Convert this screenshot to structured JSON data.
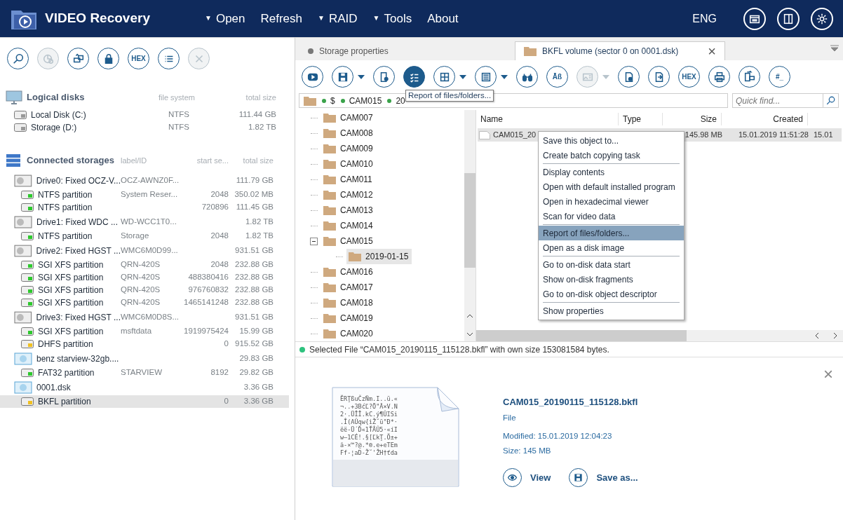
{
  "app": {
    "title": "VIDEO Recovery"
  },
  "menu": [
    {
      "label": "Open",
      "dropdown": true
    },
    {
      "label": "Refresh",
      "dropdown": false
    },
    {
      "label": "RAID",
      "dropdown": true
    },
    {
      "label": "Tools",
      "dropdown": true
    },
    {
      "label": "About",
      "dropdown": false
    }
  ],
  "dropdown_mark": "▼",
  "language": "ENG",
  "header_buttons": [
    {
      "kind": "window"
    },
    {
      "kind": "sidebar"
    },
    {
      "kind": "gear"
    }
  ],
  "left_toolbar": [
    {
      "kind": "magnifier",
      "disabled": false
    },
    {
      "kind": "pie",
      "disabled": true
    },
    {
      "kind": "drives",
      "disabled": false
    },
    {
      "kind": "lock",
      "disabled": false
    },
    {
      "kind": "hex",
      "label": "HEX",
      "disabled": false
    },
    {
      "kind": "list",
      "disabled": false
    },
    {
      "kind": "close",
      "disabled": true
    }
  ],
  "logical_disks": {
    "title": "Logical disks",
    "columns": [
      "file system",
      "total size"
    ],
    "rows": [
      {
        "name": "Local Disk (C:)",
        "file_system": "NTFS",
        "size": "111.44 GB"
      },
      {
        "name": "Storage (D:)",
        "file_system": "NTFS",
        "size": "1.82 TB"
      }
    ]
  },
  "storages": {
    "title": "Connected storages",
    "columns": [
      "label/ID",
      "start se...",
      "total size"
    ],
    "devices": [
      {
        "name": "Drive0: Fixed OCZ-V...",
        "kind": "drive",
        "label": "OCZ-AWNZ0F...",
        "size": "111.79 GB",
        "selected": false,
        "children": [
          {
            "name": "NTFS partition",
            "label": "System Reser...",
            "start": "2048",
            "size": "350.02 MB",
            "color": "#2ec82e",
            "selected": false
          },
          {
            "name": "NTFS partition",
            "start": "720896",
            "size": "111.45 GB",
            "color": "#2ec82e",
            "selected": false
          }
        ]
      },
      {
        "name": "Drive1: Fixed WDC ...",
        "kind": "drive",
        "label": "WD-WCC1T0...",
        "size": "1.82 TB",
        "selected": false,
        "children": [
          {
            "name": "NTFS partition",
            "label": "Storage",
            "start": "2048",
            "size": "1.82 TB",
            "color": "#2ec82e",
            "selected": false
          }
        ]
      },
      {
        "name": "Drive2: Fixed HGST ...",
        "kind": "drive",
        "label": "WMC6M0D99...",
        "size": "931.51 GB",
        "selected": false,
        "children": [
          {
            "name": "SGI XFS partition",
            "label": "QRN-420S",
            "start": "2048",
            "size": "232.88 GB",
            "color": "#2ec82e",
            "selected": false
          },
          {
            "name": "SGI XFS partition",
            "label": "QRN-420S",
            "start": "488380416",
            "size": "232.88 GB",
            "color": "#2ec82e",
            "selected": false
          },
          {
            "name": "SGI XFS partition",
            "label": "QRN-420S",
            "start": "976760832",
            "size": "232.88 GB",
            "color": "#2ec82e",
            "selected": false
          },
          {
            "name": "SGI XFS partition",
            "label": "QRN-420S",
            "start": "1465141248",
            "size": "232.88 GB",
            "color": "#2ec82e",
            "selected": false
          }
        ]
      },
      {
        "name": "Drive3: Fixed HGST ...",
        "kind": "drive",
        "label": "WMC6M0D8S...",
        "size": "931.51 GB",
        "selected": false,
        "children": [
          {
            "name": "SGI XFS partition",
            "label": "msftdata",
            "start": "1919975424",
            "size": "15.99 GB",
            "color": "#2ec82e",
            "selected": false
          },
          {
            "name": "DHFS partition",
            "start": "0",
            "size": "915.52 GB",
            "color": "#f0c020",
            "selected": false
          }
        ]
      },
      {
        "name": "benz starview-32gb....",
        "kind": "image",
        "size": "29.83 GB",
        "selected": false,
        "children": [
          {
            "name": "FAT32 partition",
            "label": "STARVIEW",
            "start": "8192",
            "size": "29.82 GB",
            "color": "#2ec82e",
            "selected": false
          }
        ]
      },
      {
        "name": "0001.dsk",
        "kind": "image",
        "size": "3.36 GB",
        "selected": false,
        "children": [
          {
            "name": "BKFL partition",
            "start": "0",
            "size": "3.36 GB",
            "color": "#f0c020",
            "selected": true
          }
        ]
      }
    ]
  },
  "tabs": [
    {
      "label": "Storage properties",
      "kind": "properties",
      "selected": false,
      "closable": false
    },
    {
      "label": "BKFL volume (sector 0 on 0001.dsk)",
      "kind": "folder",
      "selected": true,
      "closable": true
    }
  ],
  "tab_close": "×",
  "toolbar": [
    {
      "kind": "play",
      "disabled": false
    },
    {
      "kind": "save",
      "dropdown": true,
      "disabled": false
    },
    {
      "kind": "filegear",
      "disabled": false
    },
    {
      "kind": "checklist",
      "active": true,
      "disabled": false
    },
    {
      "kind": "grid",
      "dropdown": true,
      "disabled": false
    },
    {
      "kind": "panel",
      "dropdown": true,
      "disabled": false
    },
    {
      "kind": "binoculars",
      "disabled": false
    },
    {
      "kind": "spell",
      "label": "Āß",
      "disabled": false
    },
    {
      "kind": "picture",
      "dropdown": true,
      "disabled": true
    },
    {
      "kind": "docgear",
      "disabled": false
    },
    {
      "kind": "docexport",
      "disabled": false
    },
    {
      "kind": "hex",
      "label": "HEX",
      "disabled": false
    },
    {
      "kind": "printer",
      "disabled": false
    },
    {
      "kind": "transfer",
      "disabled": false
    },
    {
      "kind": "hash",
      "label": "#_",
      "disabled": false
    }
  ],
  "tooltip": "Report of files/folders...",
  "path": {
    "crumbs": [
      "$",
      "CAM015",
      "20"
    ]
  },
  "quick_find": {
    "placeholder": "Quick find..."
  },
  "tree": [
    {
      "label": "CAM007",
      "selected": false
    },
    {
      "label": "CAM008",
      "selected": false
    },
    {
      "label": "CAM009",
      "selected": false
    },
    {
      "label": "CAM010",
      "selected": false
    },
    {
      "label": "CAM011",
      "selected": false
    },
    {
      "label": "CAM012",
      "selected": false
    },
    {
      "label": "CAM013",
      "selected": false
    },
    {
      "label": "CAM014",
      "selected": false
    },
    {
      "label": "CAM015",
      "selected": false,
      "expanded": true,
      "children": [
        {
          "label": "2019-01-15",
          "selected": true
        }
      ]
    },
    {
      "label": "CAM016",
      "selected": false
    },
    {
      "label": "CAM017",
      "selected": false
    },
    {
      "label": "CAM018",
      "selected": false
    },
    {
      "label": "CAM019",
      "selected": false
    },
    {
      "label": "CAM020",
      "selected": false
    }
  ],
  "file_list": {
    "columns": [
      "Name",
      "Type",
      "Size",
      "Created"
    ],
    "rows": [
      {
        "name": "CAM015_20",
        "size": "145.98 MB",
        "created": "15.01.2019 11:51:28",
        "column_5": "15.01",
        "selected": true
      }
    ]
  },
  "context_menu": {
    "groups": [
      [
        {
          "label": "Save this object to...",
          "selected": false
        },
        {
          "label": "Create batch copying task",
          "selected": false
        }
      ],
      [
        {
          "label": "Display contents",
          "selected": false
        },
        {
          "label": "Open with default installed program",
          "selected": false
        },
        {
          "label": "Open in hexadecimal viewer",
          "selected": false
        },
        {
          "label": "Scan for video data",
          "selected": false
        }
      ],
      [
        {
          "label": "Report of files/folders...",
          "selected": true
        },
        {
          "label": "Open as a disk image",
          "selected": false
        }
      ],
      [
        {
          "label": "Go to on-disk data start",
          "selected": false
        },
        {
          "label": "Show on-disk fragments",
          "selected": false
        },
        {
          "label": "Go to on-disk object descriptor",
          "selected": false
        }
      ],
      [
        {
          "label": "Show properties",
          "selected": false
        }
      ]
    ]
  },
  "status": {
    "text": "Selected File “CAM015_20190115_115128.bkfl” with own size 153081584 bytes.",
    "color": "#2ec27e"
  },
  "preview": {
    "close": "×",
    "thumbnail_lines": [
      "ĔRŢßuČzÑm.I..ü.«",
      "¬..+3BćĽ?Ö\"Ã×V.N",
      "2·.ÜÎÎ.kC.ý¶ÛISi",
      ".Î(AÛqw{iŽ˘ü\"Ð*·",
      "ëë-Ü´Ď«1ŤÂÛ5·«íI",
      "w—1CÉ!.§[ĽkŢ.Õ±+",
      "ă-×™?@.*®.e+eTEm",
      "Ff-¦aD-Ž˘'ŽH†ťda"
    ],
    "file_name": "CAM015_20190115_115128.bkfl",
    "type": "File",
    "modified": "Modified: 15.01.2019 12:04:23",
    "size": "Size: 145 MB",
    "actions": [
      {
        "kind": "view",
        "label": "View"
      },
      {
        "kind": "save",
        "label": "Save as..."
      }
    ]
  }
}
